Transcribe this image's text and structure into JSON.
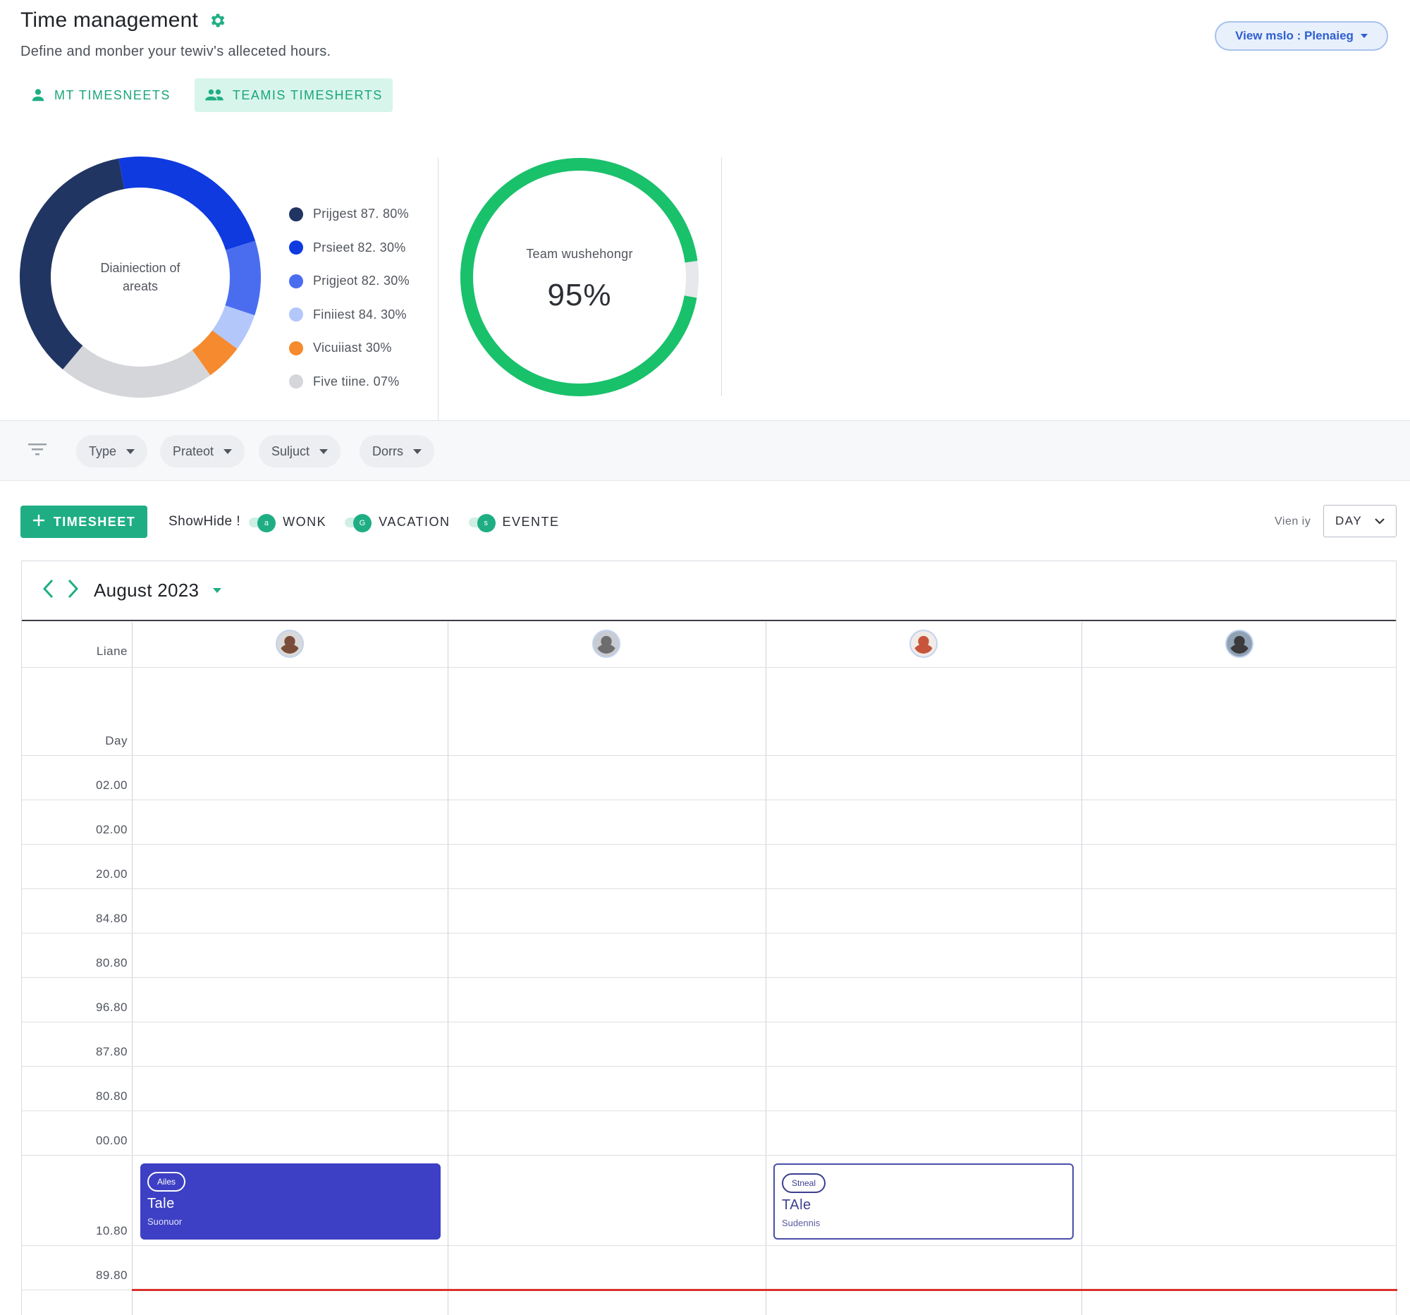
{
  "header": {
    "title": "Time management",
    "subtitle": "Define and monber your tewiv's alleceted hours.",
    "view_mode_label": "View mslo : Plenaieg"
  },
  "tabs": [
    {
      "label": "MT TIMESNEETS",
      "icon": "person-icon",
      "active": false
    },
    {
      "label": "TEAMIS TIMESHERTS",
      "icon": "group-icon",
      "active": true
    }
  ],
  "charts": {
    "donut_center_label": "Diainiection of areats",
    "gauge_label": "Team wushehongr",
    "gauge_value_label": "95%"
  },
  "chart_data": [
    {
      "type": "pie",
      "title": "Diainiection of areats",
      "legend_position": "right",
      "slices": [
        {
          "label": "Prijgest 87. 80%",
          "value": 36,
          "color": "#213563"
        },
        {
          "label": "Prsieet 82. 30%",
          "value": 23,
          "color": "#0f3ae0"
        },
        {
          "label": "Prigjeot 82. 30%",
          "value": 10,
          "color": "#4a6df0"
        },
        {
          "label": "Finiiest 84. 30%",
          "value": 5,
          "color": "#b3c7fb"
        },
        {
          "label": "Vicuiiast 30%",
          "value": 5,
          "color": "#f58a2e"
        },
        {
          "label": "Five tiine. 07%",
          "value": 21,
          "color": "#d4d6da"
        }
      ]
    },
    {
      "type": "pie",
      "title": "Team wushehongr",
      "percent": 95,
      "colors": {
        "fill": "#19c16b",
        "track": "#e6e8eb"
      }
    }
  ],
  "filters": {
    "chips": [
      {
        "label": "Type"
      },
      {
        "label": "Prateot"
      },
      {
        "label": "Suljuct"
      },
      {
        "label": "Dorrs"
      }
    ]
  },
  "toolbar": {
    "add_button_label": "TIMESHEET",
    "show_hide_label": "ShowHide !",
    "toggles": [
      {
        "label": "WONK",
        "knob": "a"
      },
      {
        "label": "VACATION",
        "knob": "G"
      },
      {
        "label": "EVENTE",
        "knob": "s"
      }
    ],
    "view_by_label": "Vien iy",
    "view_by_value": "DAY"
  },
  "calendar": {
    "month_label": "August 2023",
    "header_label": "Liane",
    "rows": [
      "Day",
      "02.00",
      "02.00",
      "20.00",
      "84.80",
      "80.80",
      "96.80",
      "87.80",
      "80.80",
      "00.00",
      "10.80",
      "89.80"
    ],
    "avatars": [
      {
        "color": "#7a4c3a",
        "bg": "#d9d9d9"
      },
      {
        "color": "#6d6d6d",
        "bg": "#c8ccd2"
      },
      {
        "color": "#c7553c",
        "bg": "#f2ece8"
      },
      {
        "color": "#3b3b3b",
        "bg": "#8fa1b3"
      }
    ],
    "events": [
      {
        "pill": "Ailes",
        "title": "Tale",
        "subtitle": "Suonuor",
        "style": "filled"
      },
      {
        "pill": "Stneal",
        "title": "TAle",
        "subtitle": "Sudennis",
        "style": "outlined"
      }
    ]
  },
  "colors": {
    "accent": "#1fae84",
    "now_line": "#d9322b"
  }
}
